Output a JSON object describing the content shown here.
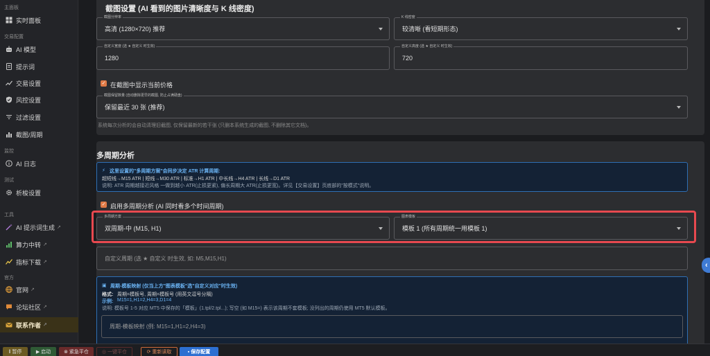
{
  "sidebar": {
    "s_main": "主面板",
    "nav_realtime": "实时面板",
    "s_trade": "交易配置",
    "nav_ai_model": "AI 模型",
    "nav_prompt": "提示词",
    "nav_trade": "交易设置",
    "nav_risk": "风控设置",
    "nav_filter": "过滤设置",
    "nav_shot": "截图/周期",
    "s_monitor": "监控",
    "nav_ai_log": "AI 日志",
    "s_test": "测试",
    "nav_backtest": "析梭设置",
    "s_tools": "工具",
    "nav_prompt_gen": "AI 提示词生成",
    "nav_compute": "算力中转",
    "nav_indicator": "指标下载",
    "s_official": "官方",
    "nav_website": "官网",
    "nav_forum": "论坛社区",
    "nav_contact": "联系作者",
    "ext": "↗"
  },
  "screenshot": {
    "title": "截图设置 (AI 看到的图片清晰度与 K 线密度)",
    "resolution_label": "截图分辨率",
    "resolution_value": "高清 (1280×720) 推荐",
    "kdensity_label": "K 线密度",
    "kdensity_value": "较清晰 (看短期形态)",
    "width_label": "自定义宽度 (选 ★ 自定义 时生效)",
    "width_value": "1280",
    "height_label": "自定义高度 (选 ★ 自定义 时生效)",
    "height_value": "720",
    "show_price_label": "在截图中显示当前价格",
    "retention_label": "截图保留数量 (自动删除更早的截图, 防止占满硬盘)",
    "retention_value": "保留最近 30 张 (推荐)",
    "retention_hint": "系统每次分析的会自动清理旧截图, 仅保留最新的若干张 (只删本系统生成的截图, 不删除其它文档)。"
  },
  "multi": {
    "title": "多周期分析",
    "info_title": "这里设置的\"多周期方案\"会同步决定 ATR 计算周期:",
    "info_line1": "超短线→M15 ATR | 短线→M30 ATR | 标准→H1 ATR | 中长线→H4 ATR | 长线→D1 ATR",
    "info_line2": "说明: ATR 周期越接近风格 一做到越小 ATR(止损更紧), 偏长周期大 ATR(止损更宽)。详见【交易设置】页底部的\"按模式\"说明。",
    "enable_label": "启用多周期分析 (AI 同时看多个时间周期)",
    "scheme_label": "多周期方案",
    "scheme_value": "双周期-中 (M15, H1)",
    "template_label": "图表模板",
    "template_value": "模板 1 (所有周期统一用模板 1)",
    "custom_placeholder": "自定义周期 (选 ★ 自定义 时生效, 如: M5,M15,H1)",
    "map_title": "周期-模板映射 (仅当上方\"图表模板\"选\"自定义对应\"时生效)",
    "map_fmt_k": "格式:",
    "map_fmt_v": "周期=模板号, 周期=模板号 (用英文逗号分隔)",
    "map_ex_k": "示例:",
    "map_ex_v": "M15=1,H1=2,H4=3,D1=4",
    "map_desc": "说明: 模板号 1-5 对应 MT5 中保存的「模板」(1.tpl/2.tpl...); 写空 (如 M15=) 表示该周期不套模板; 没列出的周期仍使用 MT5 默认模板。",
    "map_placeholder": "周期-模板映射 (例: M15=1,H1=2,H4=3)"
  },
  "footer": {
    "pause": "暂停",
    "start": "启动",
    "emergency": "紧急平仓",
    "close_all": "一键平仓",
    "reload": "重新读取",
    "save": "保存配置"
  },
  "colors": {
    "accent": "#e07a46",
    "highlight": "#e8494f",
    "info": "#2e6fb5",
    "save": "#2d6fd1"
  }
}
